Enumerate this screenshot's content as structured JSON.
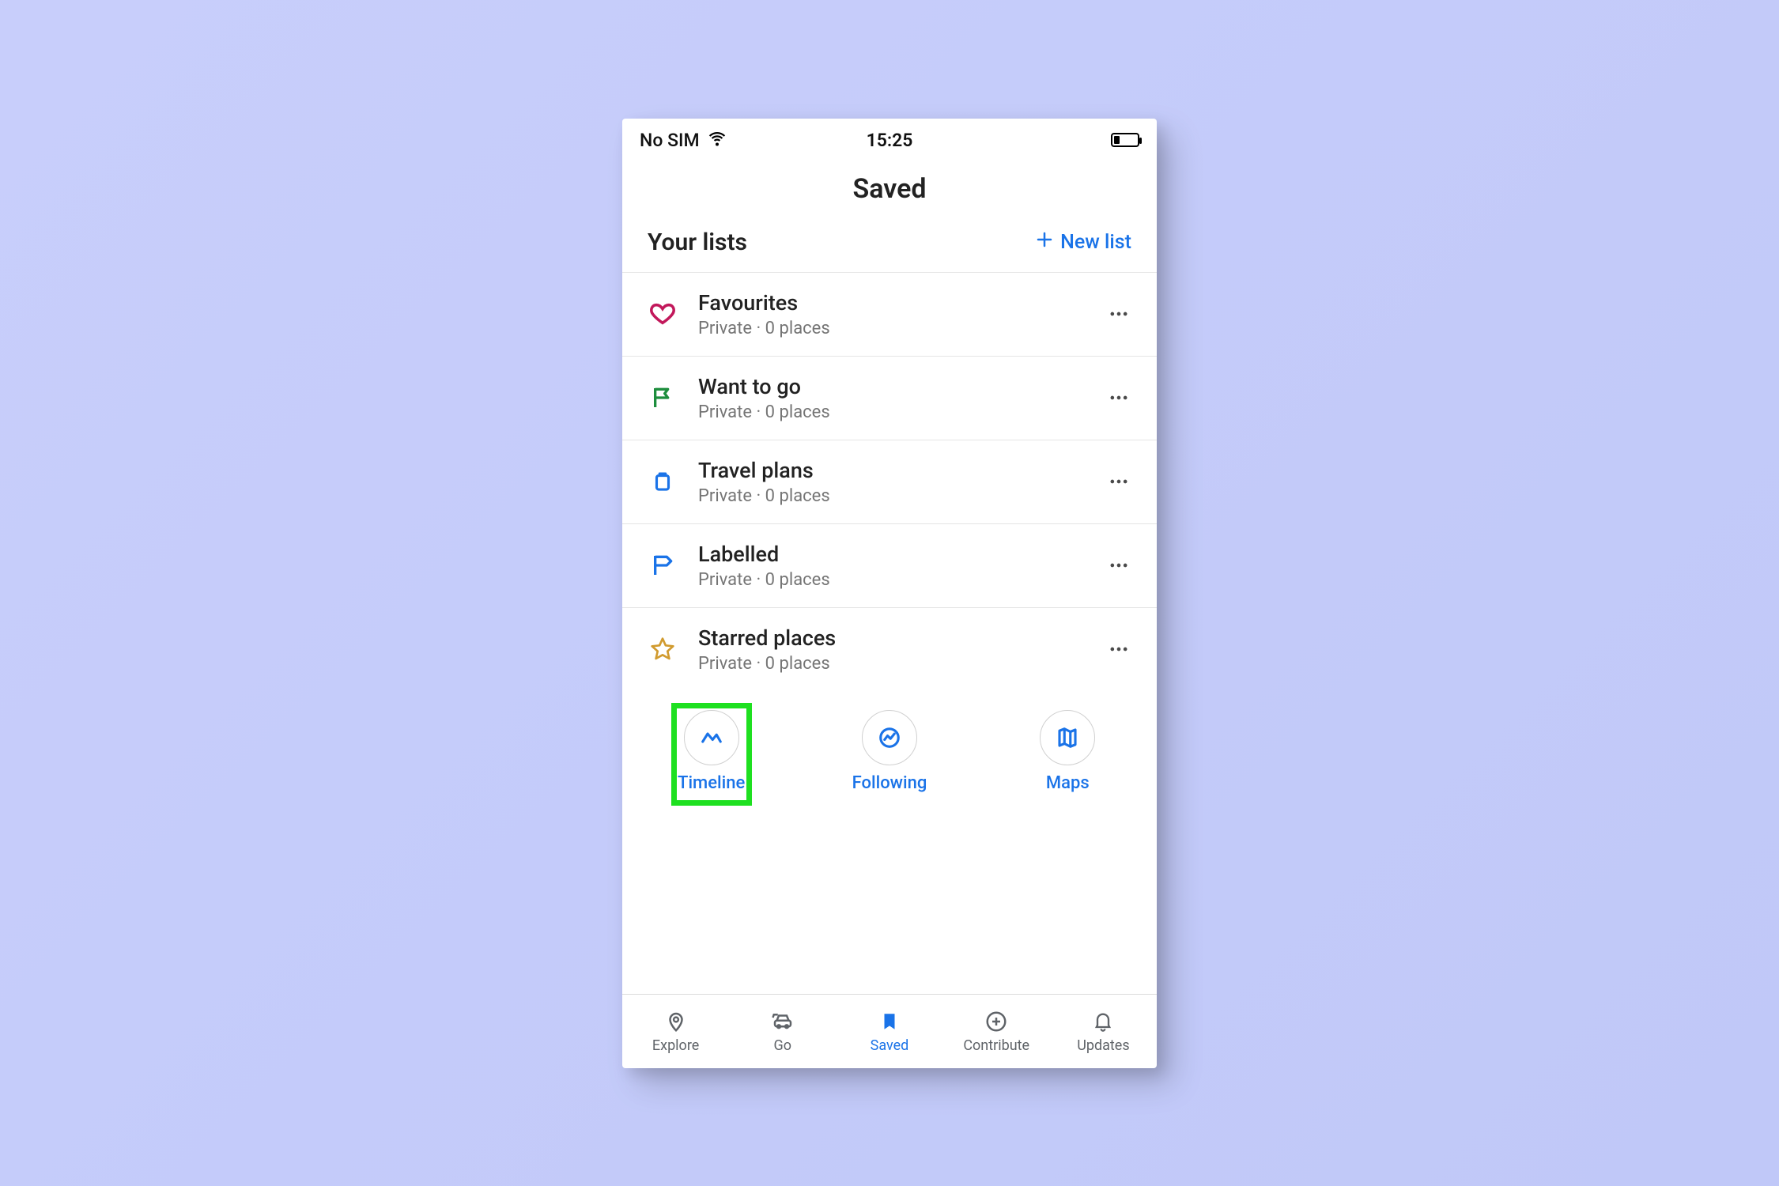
{
  "statusbar": {
    "carrier": "No SIM",
    "time": "15:25"
  },
  "header": {
    "title": "Saved"
  },
  "section": {
    "title": "Your lists",
    "new_label": "New list"
  },
  "lists": [
    {
      "title": "Favourites",
      "subtitle": "Private · 0 places",
      "icon": "heart",
      "color": "#c2185b"
    },
    {
      "title": "Want to go",
      "subtitle": "Private · 0 places",
      "icon": "flag",
      "color": "#1e8e3e"
    },
    {
      "title": "Travel plans",
      "subtitle": "Private · 0 places",
      "icon": "suitcase",
      "color": "#1a73e8"
    },
    {
      "title": "Labelled",
      "subtitle": "Private · 0 places",
      "icon": "label",
      "color": "#1a73e8"
    },
    {
      "title": "Starred places",
      "subtitle": "Private · 0 places",
      "icon": "star",
      "color": "#d19b2f"
    }
  ],
  "chips": [
    {
      "label": "Timeline",
      "icon": "timeline",
      "highlighted": true
    },
    {
      "label": "Following",
      "icon": "following",
      "highlighted": false
    },
    {
      "label": "Maps",
      "icon": "maps",
      "highlighted": false
    }
  ],
  "nav": [
    {
      "label": "Explore",
      "icon": "pin",
      "active": false
    },
    {
      "label": "Go",
      "icon": "car",
      "active": false
    },
    {
      "label": "Saved",
      "icon": "bookmark",
      "active": true
    },
    {
      "label": "Contribute",
      "icon": "plus-badge",
      "active": false
    },
    {
      "label": "Updates",
      "icon": "bell",
      "active": false
    }
  ],
  "highlight_color": "#1ee020"
}
